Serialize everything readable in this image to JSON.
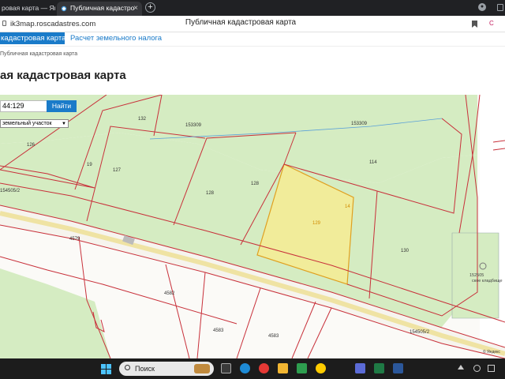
{
  "browser": {
    "tabs": [
      {
        "label": "ровая карта — Янд",
        "active": false
      },
      {
        "label": "Публичная кадастро",
        "active": true
      }
    ],
    "new_tab_symbol": "+",
    "url": "ik3map.roscadastres.com",
    "page_title": "Публичная кадастровая карта",
    "right_badge": "С"
  },
  "site": {
    "nav": {
      "active_tab": "кадастровая карта",
      "tab2": "Расчет земельного налога"
    },
    "breadcrumb": "Публичная кадастровая карта",
    "heading": "ая кадастровая карта"
  },
  "map": {
    "search_value": "44:129",
    "search_button": "Найти",
    "type_select": "земельный участок",
    "parcel_labels": [
      {
        "text": "132",
        "kind": "parcel"
      },
      {
        "text": "153309",
        "kind": "parcel"
      },
      {
        "text": "153309",
        "kind": "parcel"
      },
      {
        "text": "126",
        "kind": "parcel"
      },
      {
        "text": "19",
        "kind": "parcel"
      },
      {
        "text": "127",
        "kind": "parcel"
      },
      {
        "text": "114",
        "kind": "parcel"
      },
      {
        "text": "128",
        "kind": "parcel"
      },
      {
        "text": "128",
        "kind": "parcel"
      },
      {
        "text": "154505/2",
        "kind": "parcel"
      },
      {
        "text": "14",
        "kind": "selected"
      },
      {
        "text": "129",
        "kind": "selected"
      },
      {
        "text": "4579",
        "kind": "parcel"
      },
      {
        "text": "130",
        "kind": "parcel"
      },
      {
        "text": "4582",
        "kind": "parcel"
      },
      {
        "text": "4583",
        "kind": "parcel"
      },
      {
        "text": "4583",
        "kind": "parcel"
      },
      {
        "text": "154505/2",
        "kind": "parcel"
      }
    ],
    "poi": {
      "code": "152505",
      "name": "ское кладбище"
    },
    "attribution": "© Яндекс"
  },
  "taskbar": {
    "search_label": "Поиск",
    "apps": [
      "file-manager-icon",
      "edge-icon",
      "yandex-icon",
      "folder-icon",
      "app-green-icon",
      "yandex-browser-icon",
      "photos-icon",
      "excel-icon",
      "word-icon"
    ]
  },
  "colors": {
    "accent": "#1a7bc9",
    "map_green": "#d5ecc2",
    "selected_parcel": "#f1ec9a",
    "boundary": "#c8303a"
  }
}
